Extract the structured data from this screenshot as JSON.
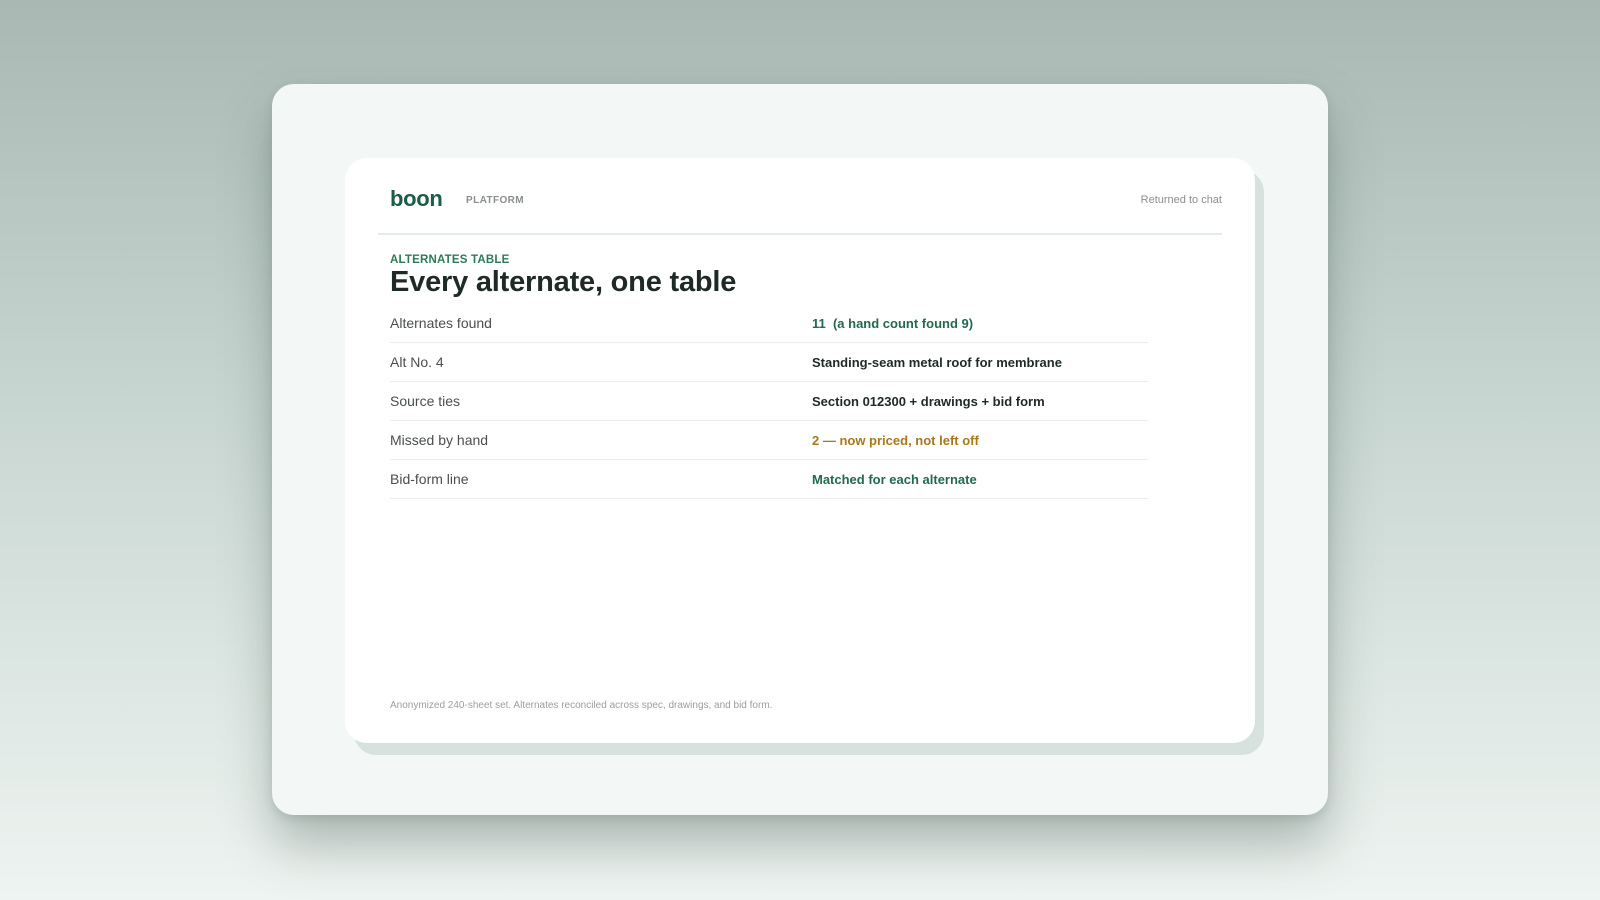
{
  "app": {
    "brand": "boon",
    "section_tag": "PLATFORM",
    "status": "Returned to chat"
  },
  "main": {
    "eyebrow": "ALTERNATES TABLE",
    "title": "Every alternate, one table",
    "rows": [
      {
        "label": "Alternates found",
        "value": "11  (a hand count found 9)",
        "tone": "green"
      },
      {
        "label": "Alt No. 4",
        "value": "Standing-seam metal roof for membrane",
        "tone": "dark"
      },
      {
        "label": "Source ties",
        "value": "Section 012300 + drawings + bid form",
        "tone": "dark"
      },
      {
        "label": "Missed by hand",
        "value": "2 — now priced, not left off",
        "tone": "amber"
      },
      {
        "label": "Bid-form line",
        "value": "Matched for each alternate",
        "tone": "green"
      }
    ],
    "footnote": "Anonymized 240-sheet set. Alternates reconciled across spec, drawings, and bid form."
  },
  "colors": {
    "brand_green": "#1f5c45",
    "accent_green": "#23694c",
    "accent_amber": "#a8781a",
    "text_dark": "#1f2a26"
  }
}
